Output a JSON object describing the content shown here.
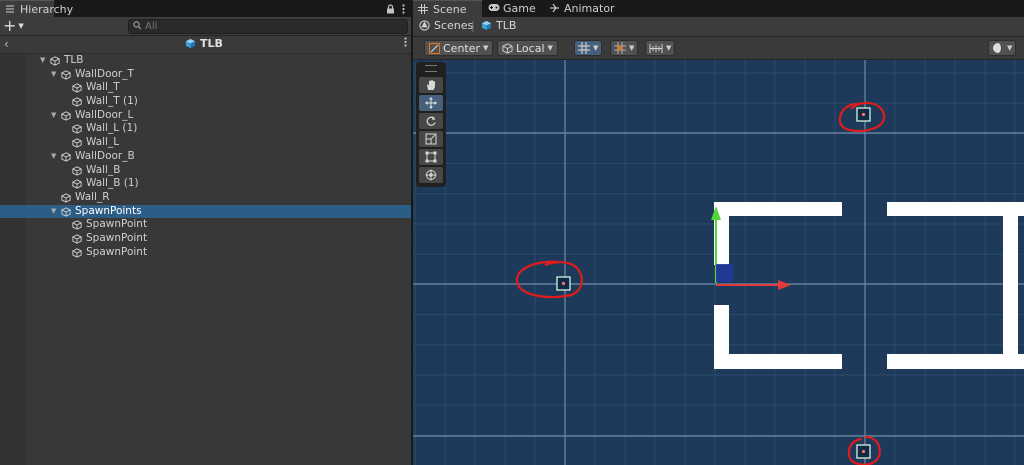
{
  "hierarchy": {
    "tab_label": "Hierarchy",
    "search_placeholder": "All",
    "scene_title": "TLB",
    "items": [
      {
        "label": "TLB",
        "depth": 0,
        "expanded": true,
        "selected": false
      },
      {
        "label": "WallDoor_T",
        "depth": 1,
        "expanded": true,
        "selected": false
      },
      {
        "label": "Wall_T",
        "depth": 2,
        "expanded": null,
        "selected": false
      },
      {
        "label": "Wall_T (1)",
        "depth": 2,
        "expanded": null,
        "selected": false
      },
      {
        "label": "WallDoor_L",
        "depth": 1,
        "expanded": true,
        "selected": false
      },
      {
        "label": "Wall_L (1)",
        "depth": 2,
        "expanded": null,
        "selected": false
      },
      {
        "label": "Wall_L",
        "depth": 2,
        "expanded": null,
        "selected": false
      },
      {
        "label": "WallDoor_B",
        "depth": 1,
        "expanded": true,
        "selected": false
      },
      {
        "label": "Wall_B",
        "depth": 2,
        "expanded": null,
        "selected": false
      },
      {
        "label": "Wall_B (1)",
        "depth": 2,
        "expanded": null,
        "selected": false
      },
      {
        "label": "Wall_R",
        "depth": 1,
        "expanded": null,
        "selected": false
      },
      {
        "label": "SpawnPoints",
        "depth": 1,
        "expanded": true,
        "selected": true
      },
      {
        "label": "SpawnPoint",
        "depth": 2,
        "expanded": null,
        "selected": false
      },
      {
        "label": "SpawnPoint",
        "depth": 2,
        "expanded": null,
        "selected": false
      },
      {
        "label": "SpawnPoint",
        "depth": 2,
        "expanded": null,
        "selected": false
      }
    ]
  },
  "scene": {
    "tabs": [
      {
        "label": "Scene",
        "icon": "grid-icon",
        "active": true
      },
      {
        "label": "Game",
        "icon": "gamepad-icon",
        "active": false
      },
      {
        "label": "Animator",
        "icon": "animator-icon",
        "active": false
      }
    ],
    "breadcrumb": {
      "root": "Scenes",
      "current": "TLB"
    },
    "toolbar": {
      "pivot": "Center",
      "space": "Local"
    },
    "colors": {
      "grid_background": "#1e3a5a",
      "selection": "#2c5d87",
      "walls": "#ffffff",
      "gizmo_x": "#e33b3b",
      "gizmo_y": "#52d63a",
      "annotation": "#e21b1b"
    }
  }
}
